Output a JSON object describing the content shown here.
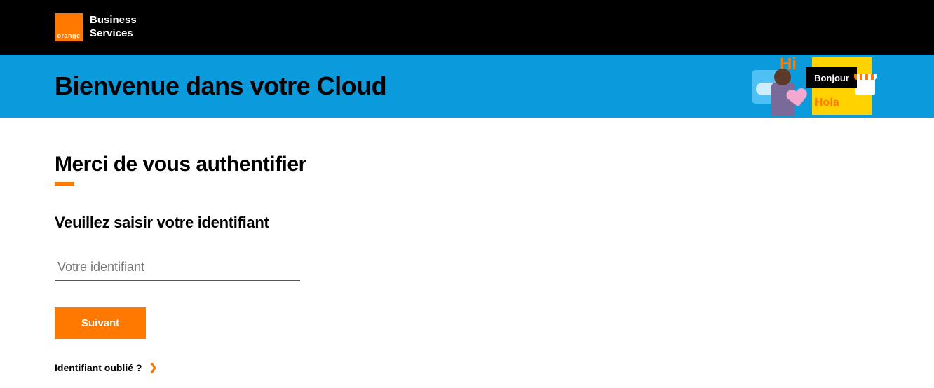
{
  "brand": {
    "logo_small_text": "orange",
    "line1": "Business",
    "line2": "Services"
  },
  "banner": {
    "title": "Bienvenue dans votre Cloud",
    "illus": {
      "hi": "Hi",
      "bonjour": "Bonjour",
      "hola": "Hola"
    }
  },
  "auth": {
    "title": "Merci de vous authentifier",
    "input_label": "Veuillez saisir votre identifiant",
    "input_placeholder": "Votre identifiant",
    "next_label": "Suivant",
    "forgot_label": "Identifiant oublié ?"
  },
  "colors": {
    "accent": "#ff7900",
    "banner": "#0b9bdc"
  }
}
